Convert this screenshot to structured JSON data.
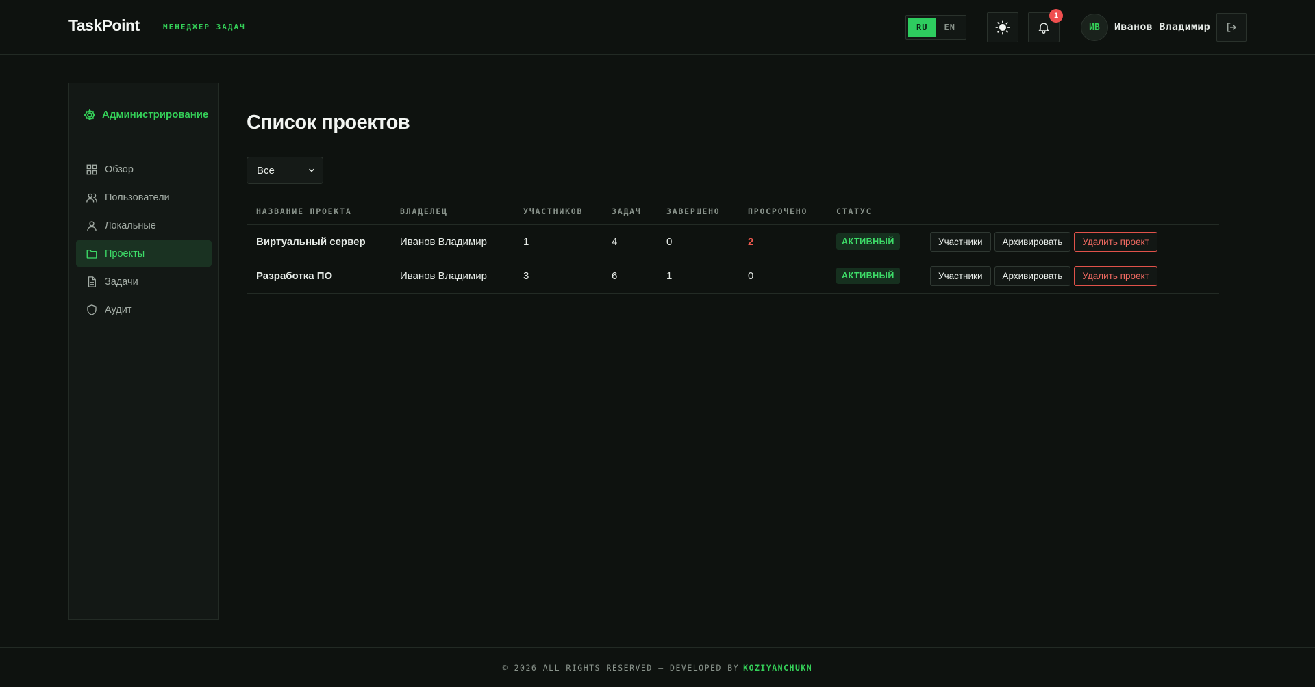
{
  "header": {
    "logo": "TaskPoint",
    "logo_sub": "МЕНЕДЖЕР ЗАДАЧ",
    "lang": {
      "ru": "RU",
      "en": "EN",
      "active": "RU"
    },
    "notifications_count": "1",
    "avatar_initials": "ИВ",
    "username": "Иванов Владимир"
  },
  "sidebar": {
    "title": "Администрирование",
    "items": [
      {
        "label": "Обзор",
        "icon": "grid-icon"
      },
      {
        "label": "Пользователи",
        "icon": "users-icon"
      },
      {
        "label": "Локальные",
        "icon": "user-icon"
      },
      {
        "label": "Проекты",
        "icon": "folder-icon",
        "active": true
      },
      {
        "label": "Задачи",
        "icon": "document-icon"
      },
      {
        "label": "Аудит",
        "icon": "shield-icon"
      }
    ]
  },
  "main": {
    "title": "Список проектов",
    "filter_value": "Все",
    "columns": [
      "НАЗВАНИЕ ПРОЕКТА",
      "ВЛАДЕЛЕЦ",
      "УЧАСТНИКОВ",
      "ЗАДАЧ",
      "ЗАВЕРШЕНО",
      "ПРОСРОЧЕНО",
      "СТАТУС"
    ],
    "rows": [
      {
        "name": "Виртуальный сервер",
        "owner": "Иванов Владимир",
        "members": "1",
        "tasks": "4",
        "done": "0",
        "overdue": "2",
        "status": "АКТИВНЫЙ"
      },
      {
        "name": "Разработка ПО",
        "owner": "Иванов Владимир",
        "members": "3",
        "tasks": "6",
        "done": "1",
        "overdue": "0",
        "status": "АКТИВНЫЙ"
      }
    ],
    "actions": {
      "members": "Участники",
      "archive": "Архивировать",
      "delete": "Удалить проект"
    }
  },
  "footer": {
    "text": "© 2026 ALL RIGHTS RESERVED — DEVELOPED BY",
    "developer": "KOZIYANCHUKN"
  },
  "colors": {
    "accent": "#34d058",
    "danger": "#f05a4f",
    "background": "#0e120f"
  }
}
